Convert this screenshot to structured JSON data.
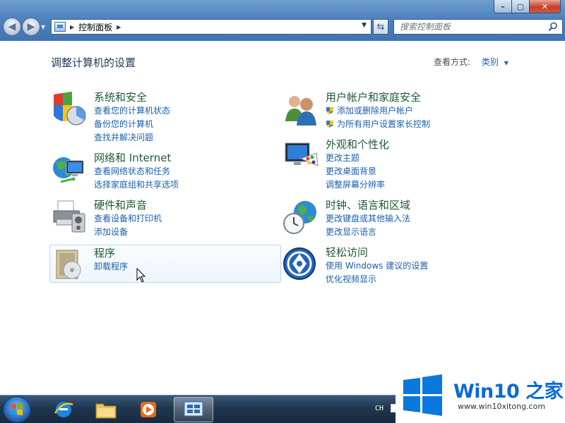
{
  "window": {
    "minimize": "–",
    "maximize": "▢",
    "close": "✕"
  },
  "address": {
    "location": "控制面板"
  },
  "search": {
    "placeholder": "搜索控制面板"
  },
  "main": {
    "title": "调整计算机的设置",
    "view_by_label": "查看方式:",
    "view_by_value": "类别"
  },
  "categories": [
    {
      "title": "系统和安全",
      "links": [
        "查看您的计算机状态",
        "备份您的计算机",
        "查找并解决问题"
      ]
    },
    {
      "title": "网络和 Internet",
      "links": [
        "查看网络状态和任务",
        "选择家庭组和共享选项"
      ]
    },
    {
      "title": "硬件和声音",
      "links": [
        "查看设备和打印机",
        "添加设备"
      ]
    },
    {
      "title": "程序",
      "links": [
        "卸载程序"
      ]
    },
    {
      "title": "用户帐户和家庭安全",
      "links": [
        "添加或删除用户帐户",
        "为所有用户设置家长控制"
      ]
    },
    {
      "title": "外观和个性化",
      "links": [
        "更改主题",
        "更改桌面背景",
        "调整屏幕分辨率"
      ]
    },
    {
      "title": "时钟、语言和区域",
      "links": [
        "更改键盘或其他输入法",
        "更改显示语言"
      ]
    },
    {
      "title": "轻松访问",
      "links": [
        "使用 Windows 建议的设置",
        "优化视频显示"
      ]
    }
  ],
  "taskbar": {
    "language": "CH",
    "apps": [
      "start-orb",
      "ie-icon",
      "explorer-icon",
      "media-player-icon",
      "control-panel-icon"
    ]
  },
  "watermark": {
    "name": "Win10 之家",
    "url": "www.win10xitong.com"
  }
}
